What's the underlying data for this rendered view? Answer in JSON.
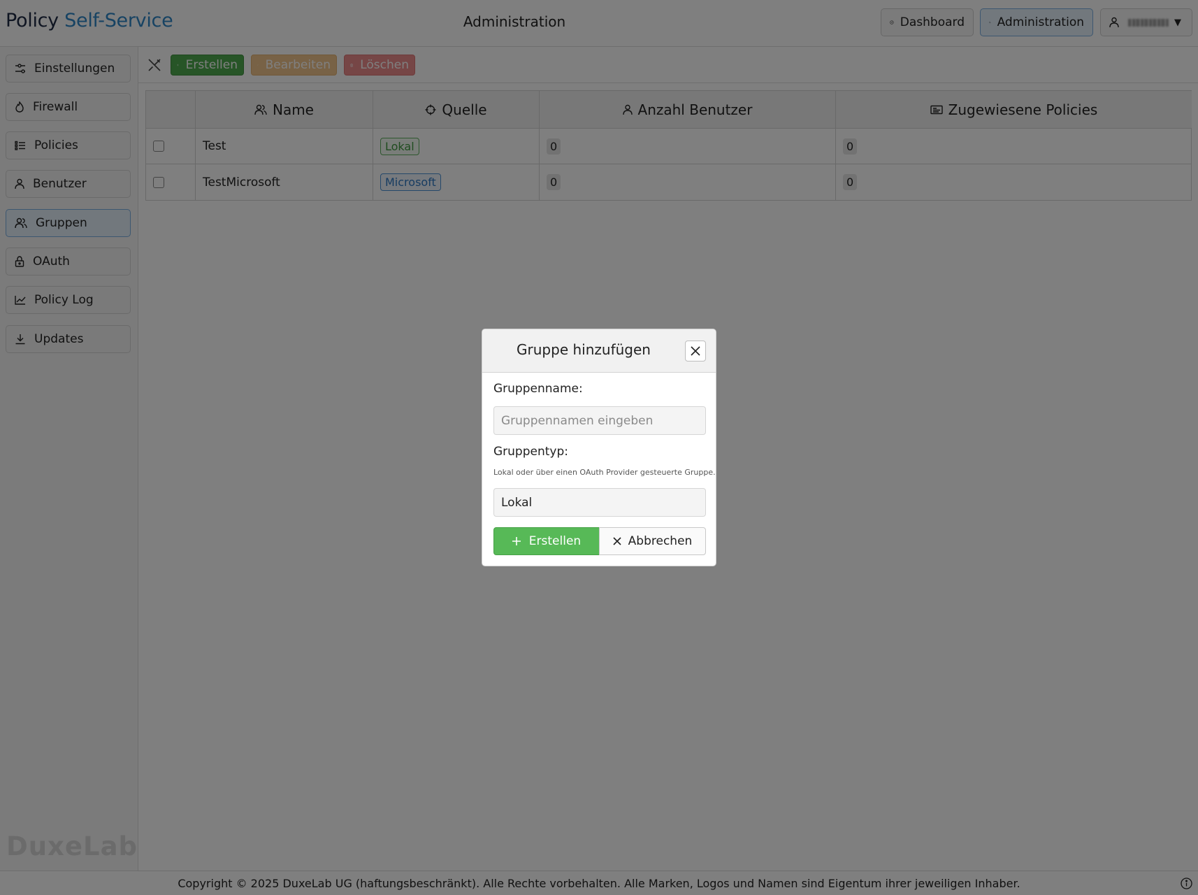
{
  "header": {
    "brand_part1": "Policy",
    "brand_part2": "Self-Service",
    "title": "Administration",
    "nav": [
      {
        "label": "Dashboard",
        "icon": "gauge-icon"
      },
      {
        "label": "Administration",
        "icon": "user-gear-icon",
        "active": true
      }
    ],
    "user_menu_icon": "user-icon"
  },
  "sidebar": {
    "items": [
      {
        "label": "Einstellungen",
        "icon": "sliders-icon"
      },
      {
        "label": "Firewall",
        "icon": "flame-icon"
      },
      {
        "label": "Policies",
        "icon": "list-icon"
      },
      {
        "label": "Benutzer",
        "icon": "user-icon"
      },
      {
        "label": "Gruppen",
        "icon": "users-icon",
        "active": true
      },
      {
        "label": "OAuth",
        "icon": "lock-icon"
      },
      {
        "label": "Policy Log",
        "icon": "chart-line-icon"
      },
      {
        "label": "Updates",
        "icon": "download-icon"
      }
    ],
    "watermark": "DuxeLab"
  },
  "toolbar": {
    "create_label": "Erstellen",
    "edit_label": "Bearbeiten",
    "delete_label": "Löschen"
  },
  "table": {
    "columns": [
      {
        "label": "",
        "icon": ""
      },
      {
        "label": "Name",
        "icon": "users-icon"
      },
      {
        "label": "Quelle",
        "icon": "crosshair-icon"
      },
      {
        "label": "Anzahl Benutzer",
        "icon": "user-icon"
      },
      {
        "label": "Zugewiesene Policies",
        "icon": "id-card-icon"
      }
    ],
    "rows": [
      {
        "name": "Test",
        "source": "Lokal",
        "source_kind": "local",
        "user_count": "0",
        "policy_count": "0"
      },
      {
        "name": "TestMicrosoft",
        "source": "Microsoft",
        "source_kind": "microsoft",
        "user_count": "0",
        "policy_count": "0"
      }
    ]
  },
  "modal": {
    "title": "Gruppe hinzufügen",
    "name_label": "Gruppenname:",
    "name_placeholder": "Gruppennamen eingeben",
    "name_value": "",
    "type_label": "Gruppentyp:",
    "type_help": "Lokal oder über einen OAuth Provider gesteuerte Gruppe.",
    "type_value": "Lokal",
    "create_label": "Erstellen",
    "cancel_label": "Abbrechen"
  },
  "footer": {
    "text": "Copyright © 2025 DuxeLab UG (haftungsbeschränkt). Alle Rechte vorbehalten. Alle Marken, Logos und Namen sind Eigentum ihrer jeweiligen Inhaber."
  },
  "colors": {
    "brand_dark": "#1f2a44",
    "brand_blue": "#2f86c7",
    "success": "#4faa4f",
    "warning": "#f1c58c",
    "danger": "#ec8d8d",
    "active_bg": "#e4f0fb"
  }
}
